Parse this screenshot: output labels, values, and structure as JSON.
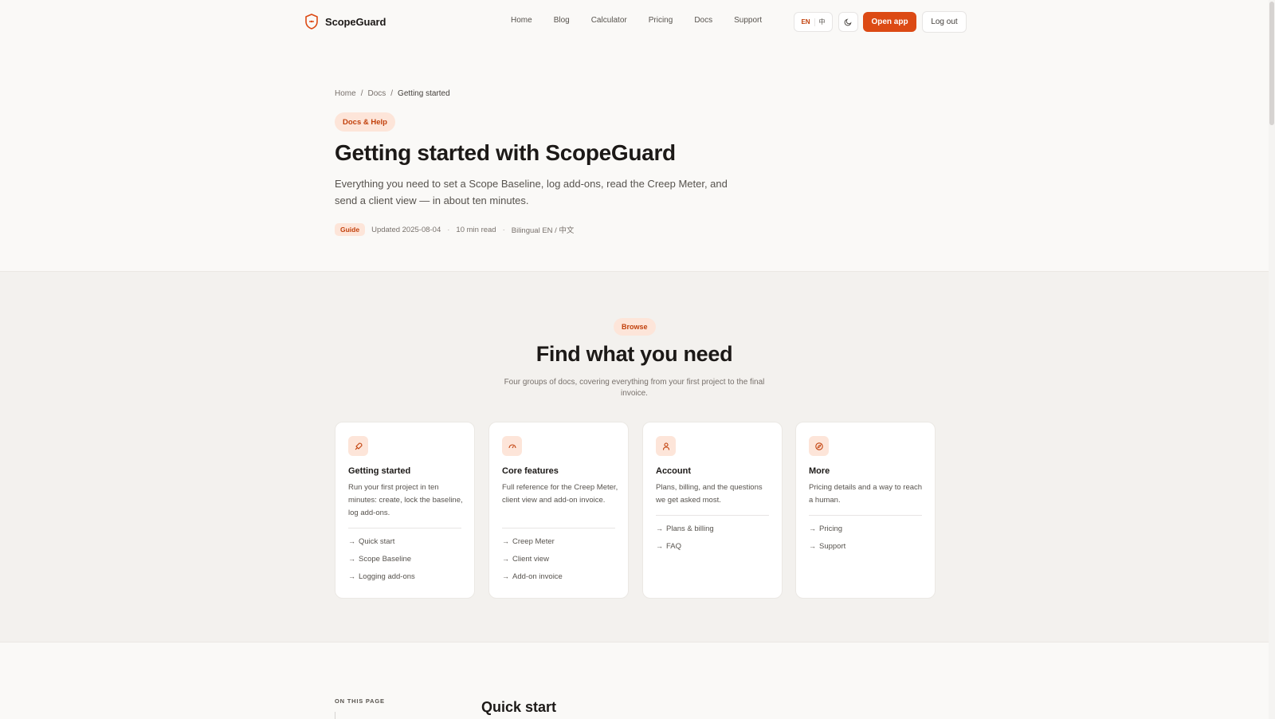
{
  "header": {
    "brand": "ScopeGuard",
    "nav": [
      "Home",
      "Blog",
      "Calculator",
      "Pricing",
      "Docs",
      "Support"
    ],
    "lang_active": "EN",
    "lang_alt": "中",
    "open_app": "Open app",
    "logout": "Log out",
    "accent_color": "#dc4a14"
  },
  "hero": {
    "breadcrumb": [
      "Home",
      "Docs",
      "Getting started"
    ],
    "pill": "Docs & Help",
    "title": "Getting started with ScopeGuard",
    "subtitle": "Everything you need to set a Scope Baseline, log add-ons, read the Creep Meter, and send a client view — in about ten minutes.",
    "meta": {
      "tag": "Guide",
      "updated": "Updated 2025-08-04",
      "read_time": "10 min read",
      "language": "Bilingual EN / 中文"
    }
  },
  "browse": {
    "pill": "Browse",
    "title": "Find what you need",
    "subtitle": "Four groups of docs, covering everything from your first project to the final invoice.",
    "cards": [
      {
        "icon": "rocket-icon",
        "title": "Getting started",
        "desc": "Run your first project in ten minutes: create, lock the baseline, log add-ons.",
        "links": [
          "Quick start",
          "Scope Baseline",
          "Logging add-ons"
        ]
      },
      {
        "icon": "gauge-icon",
        "title": "Core features",
        "desc": "Full reference for the Creep Meter, client view and add-on invoice.",
        "links": [
          "Creep Meter",
          "Client view",
          "Add-on invoice"
        ]
      },
      {
        "icon": "user-icon",
        "title": "Account",
        "desc": "Plans, billing, and the questions we get asked most.",
        "links": [
          "Plans & billing",
          "FAQ"
        ]
      },
      {
        "icon": "compass-icon",
        "title": "More",
        "desc": "Pricing details and a way to reach a human.",
        "links": [
          "Pricing",
          "Support"
        ]
      }
    ]
  },
  "content": {
    "toc_label": "ON THIS PAGE",
    "section_title": "Quick start"
  }
}
